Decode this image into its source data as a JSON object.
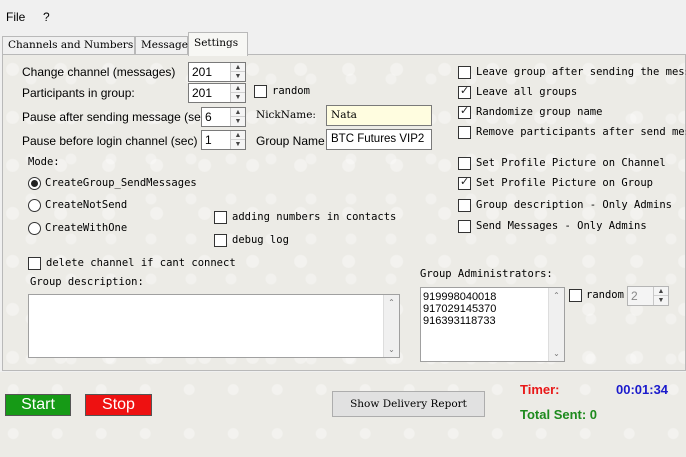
{
  "menu": {
    "file": "File",
    "help": "?"
  },
  "tabs": [
    "Channels and Numbers",
    "Message",
    "Settings"
  ],
  "settings": {
    "change_channel_label": "Change channel (messages)",
    "change_channel_value": "201",
    "participants_label": "Participants in group:",
    "participants_value": "201",
    "participants_random": "random",
    "pause_sending_label": "Pause after sending message (sec):",
    "pause_sending_value": "6",
    "pause_login_label": "Pause before login channel (sec)",
    "pause_login_value": "1",
    "nickname_label": "NickName:",
    "nickname_value": "Nata",
    "group_name_label": "Group Name",
    "group_name_value": "BTC  Futures VIP2",
    "mode_label": "Mode:",
    "modes": [
      {
        "label": "CreateGroup_SendMessages",
        "selected": true
      },
      {
        "label": "CreateNotSend",
        "selected": false
      },
      {
        "label": "CreateWithOne",
        "selected": false
      }
    ],
    "adding_numbers": {
      "label": "adding numbers in contacts",
      "checked": false
    },
    "debug_log": {
      "label": "debug log",
      "checked": false
    },
    "delete_channel": {
      "label": "delete channel if cant connect",
      "checked": false
    },
    "group_description_label": "Group description:",
    "group_description_value": "",
    "right_options": [
      {
        "label": "Leave group after sending the mess",
        "checked": false
      },
      {
        "label": "Leave all groups",
        "checked": true
      },
      {
        "label": "Randomize group name",
        "checked": true
      },
      {
        "label": "Remove participants after send mes",
        "checked": false
      },
      {
        "label": "Set Profile Picture on Channel",
        "checked": false
      },
      {
        "label": "Set Profile Picture on Group",
        "checked": true
      },
      {
        "label": "Group description - Only Admins",
        "checked": false
      },
      {
        "label": "Send Messages - Only Admins",
        "checked": false
      }
    ],
    "admins_label": "Group Administrators:",
    "admins": [
      "919998040018",
      "917029145370",
      "916393118733"
    ],
    "admins_random": "random",
    "admins_random_value": "2"
  },
  "bottom": {
    "start": "Start",
    "stop": "Stop",
    "report": "Show Delivery Report",
    "timer_label": "Timer:",
    "timer_value": "00:01:34",
    "total_sent": "Total Sent: 0"
  },
  "colors": {
    "start_bg": "#169a16",
    "stop_bg": "#ee1111",
    "timer_label": "#e81818",
    "timer_value": "#1a1acc",
    "total_sent": "#1d8a1d"
  }
}
